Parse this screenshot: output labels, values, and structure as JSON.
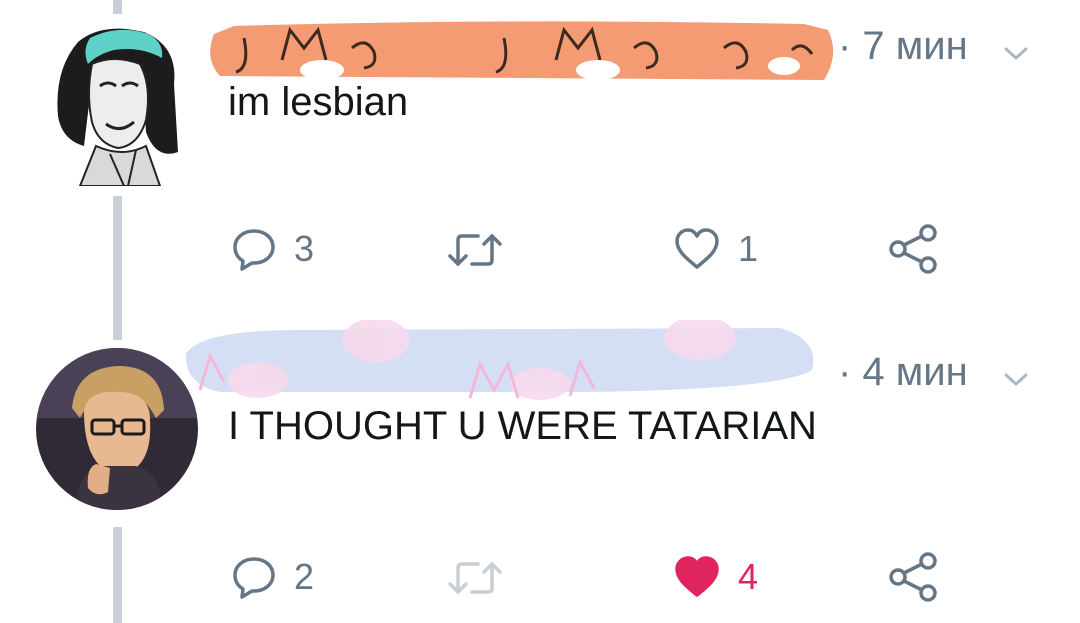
{
  "tweets": [
    {
      "time": "· 7 мин",
      "text": "im lesbian",
      "actions": {
        "reply_count": "3",
        "retweet_count": "",
        "like_count": "1"
      },
      "liked": false
    },
    {
      "time": "· 4 мин",
      "text": "I THOUGHT U WERE TATARIAN",
      "actions": {
        "reply_count": "2",
        "retweet_count": "",
        "like_count": "4"
      },
      "liked": true
    }
  ],
  "colors": {
    "text": "#14171a",
    "muted": "#657786",
    "like": "#e0245e",
    "thread_line": "#c8cfd6",
    "name_band_1": "#f28a5b",
    "name_band_2": "#c9d6f2"
  },
  "icons": [
    "reply-icon",
    "retweet-icon",
    "like-icon",
    "share-icon",
    "chevron-down-icon"
  ]
}
